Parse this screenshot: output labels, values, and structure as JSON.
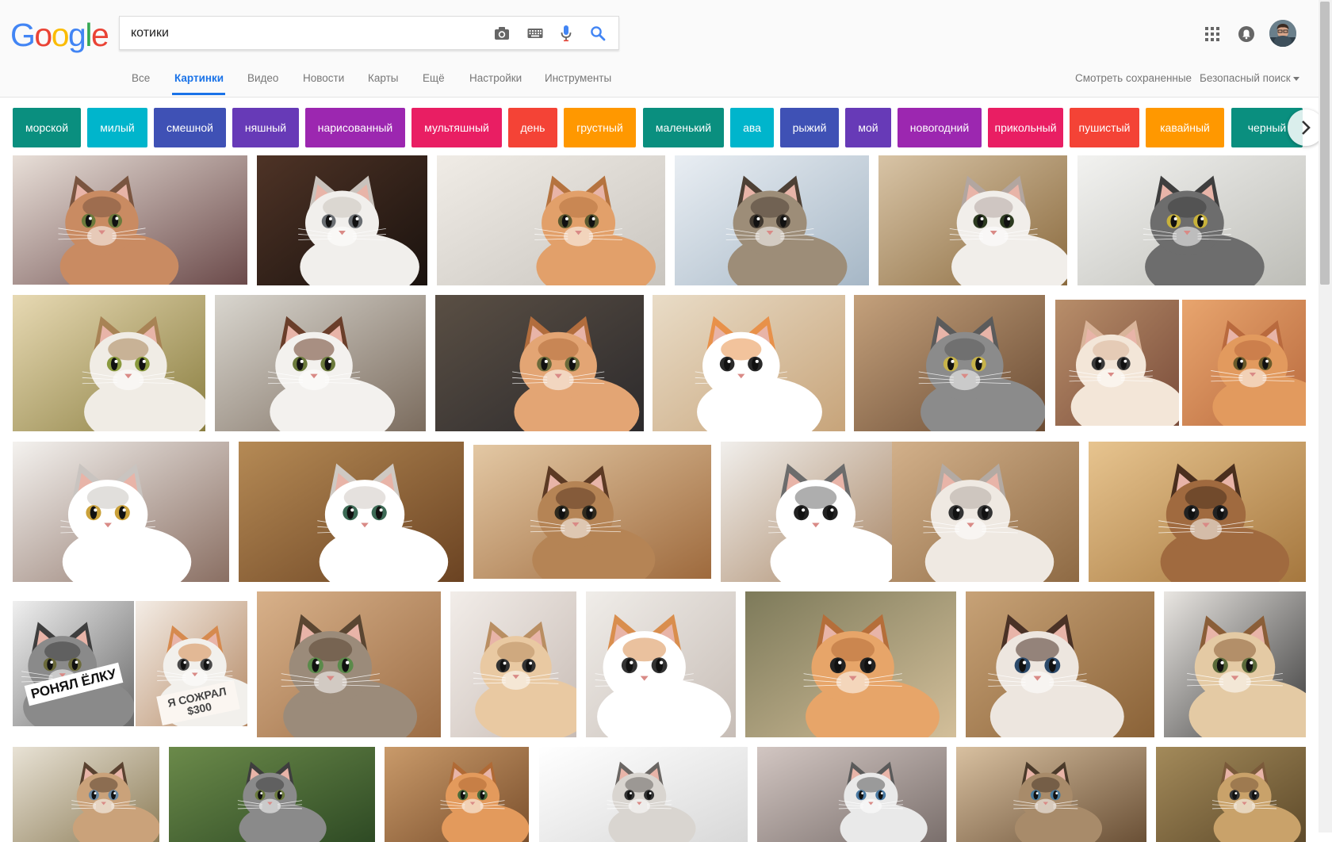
{
  "search": {
    "query": "котики"
  },
  "logo": {
    "letters": [
      "G",
      "o",
      "o",
      "g",
      "l",
      "e"
    ],
    "colors": [
      "#4285F4",
      "#EA4335",
      "#FBBC05",
      "#4285F4",
      "#34A853",
      "#EA4335"
    ]
  },
  "tabs": [
    {
      "label": "Все",
      "active": false
    },
    {
      "label": "Картинки",
      "active": true
    },
    {
      "label": "Видео",
      "active": false
    },
    {
      "label": "Новости",
      "active": false
    },
    {
      "label": "Карты",
      "active": false
    },
    {
      "label": "Ещё",
      "active": false
    },
    {
      "label": "Настройки",
      "active": false
    },
    {
      "label": "Инструменты",
      "active": false
    }
  ],
  "right_links": {
    "saved": "Смотреть сохраненные",
    "safe_search": "Безопасный поиск"
  },
  "chips": [
    {
      "label": "морской",
      "color": "#0a8f7f"
    },
    {
      "label": "милый",
      "color": "#00b5cc"
    },
    {
      "label": "смешной",
      "color": "#3f51b5"
    },
    {
      "label": "няшный",
      "color": "#673ab7"
    },
    {
      "label": "нарисованный",
      "color": "#9c27b0"
    },
    {
      "label": "мультяшный",
      "color": "#e91e63"
    },
    {
      "label": "день",
      "color": "#f44336"
    },
    {
      "label": "грустный",
      "color": "#ff9800"
    },
    {
      "label": "маленький",
      "color": "#0a8f7f"
    },
    {
      "label": "ава",
      "color": "#00b5cc"
    },
    {
      "label": "рыжий",
      "color": "#3f51b5"
    },
    {
      "label": "мой",
      "color": "#673ab7"
    },
    {
      "label": "новогодний",
      "color": "#9c27b0"
    },
    {
      "label": "прикольный",
      "color": "#e91e63"
    },
    {
      "label": "пушистый",
      "color": "#f44336"
    },
    {
      "label": "кавайный",
      "color": "#ff9800"
    },
    {
      "label": "черный",
      "color": "#0a8f7f"
    }
  ],
  "image_captions": {
    "r4c1a": "РОНЯЛ ЁЛКУ",
    "r4c1b": "Я СОЖРАЛ $300"
  },
  "icons": {
    "camera": "camera-icon",
    "keyboard": "keyboard-icon",
    "mic": "microphone-icon",
    "search": "search-icon",
    "apps": "apps-grid-icon",
    "notifications": "notifications-icon",
    "next": "chevron-right-icon"
  }
}
